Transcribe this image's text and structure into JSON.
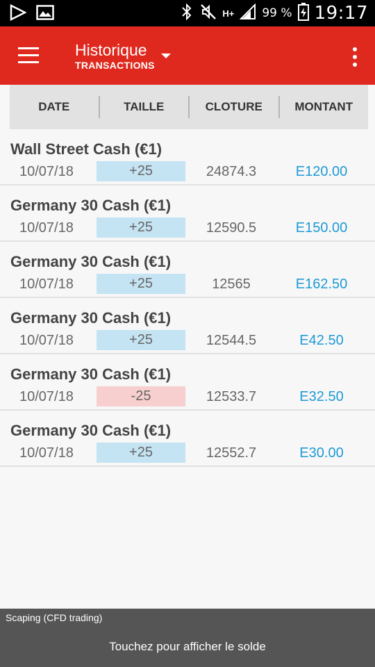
{
  "status_bar": {
    "battery_text": "99 %",
    "time": "19:17",
    "network": "H+",
    "icons": [
      "play-icon",
      "image-icon",
      "bluetooth-icon",
      "mute-icon",
      "signal-icon",
      "battery-charging-icon"
    ]
  },
  "app_bar": {
    "title": "Historique",
    "subtitle": "TRANSACTIONS",
    "background_color": "#e0291e"
  },
  "columns": [
    "DATE",
    "TAILLE",
    "CLOTURE",
    "MONTANT"
  ],
  "transactions": [
    {
      "name": "Wall Street Cash (€1)",
      "date": "10/07/18",
      "size": "+25",
      "direction": "buy",
      "close": "24874.3",
      "amount": "E120.00"
    },
    {
      "name": "Germany 30 Cash (€1)",
      "date": "10/07/18",
      "size": "+25",
      "direction": "buy",
      "close": "12590.5",
      "amount": "E150.00"
    },
    {
      "name": "Germany 30 Cash (€1)",
      "date": "10/07/18",
      "size": "+25",
      "direction": "buy",
      "close": "12565",
      "amount": "E162.50"
    },
    {
      "name": "Germany 30 Cash (€1)",
      "date": "10/07/18",
      "size": "+25",
      "direction": "buy",
      "close": "12544.5",
      "amount": "E42.50"
    },
    {
      "name": "Germany 30 Cash (€1)",
      "date": "10/07/18",
      "size": "-25",
      "direction": "sell",
      "close": "12533.7",
      "amount": "E32.50"
    },
    {
      "name": "Germany 30 Cash (€1)",
      "date": "10/07/18",
      "size": "+25",
      "direction": "buy",
      "close": "12552.7",
      "amount": "E30.00"
    }
  ],
  "bottom_bar": {
    "account_label": "Scaping (CFD trading)",
    "action_text": "Touchez pour afficher le solde"
  },
  "colors": {
    "buy": "#c4e3f3",
    "sell": "#f7cfcf",
    "amount": "#1e9ad6"
  }
}
